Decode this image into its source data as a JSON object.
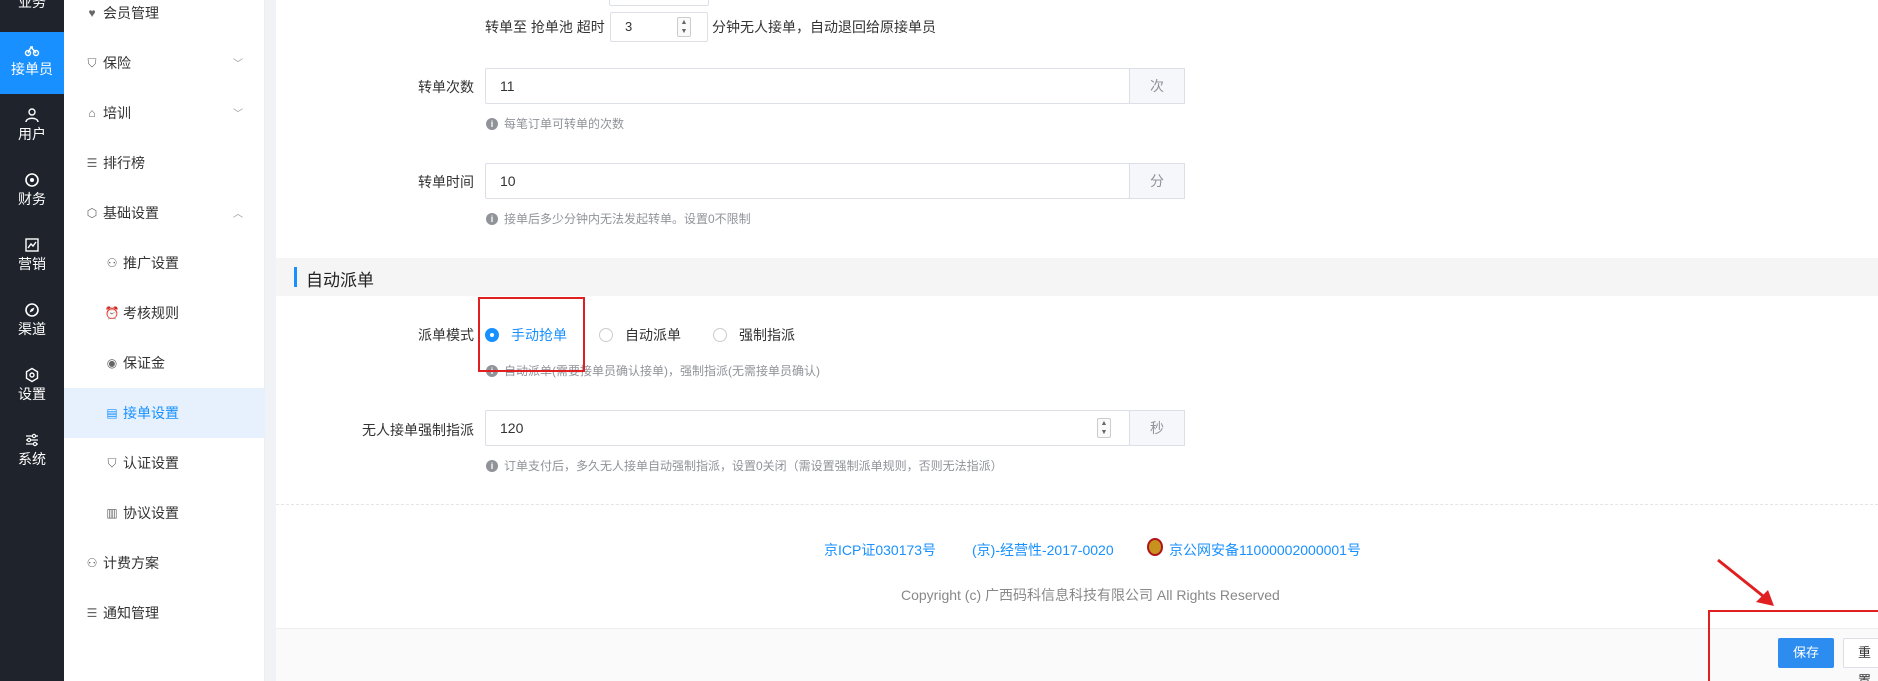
{
  "rail": {
    "top_label": "业务",
    "items": [
      {
        "label": "接单员",
        "icon": "bike-icon"
      },
      {
        "label": "用户",
        "icon": "user-icon"
      },
      {
        "label": "财务",
        "icon": "money-icon"
      },
      {
        "label": "营销",
        "icon": "chart-icon"
      },
      {
        "label": "渠道",
        "icon": "compass-icon"
      },
      {
        "label": "设置",
        "icon": "gear-icon"
      },
      {
        "label": "系统",
        "icon": "sliders-icon"
      }
    ]
  },
  "sidebar": {
    "items": [
      {
        "label": "会员管理"
      },
      {
        "label": "保险"
      },
      {
        "label": "培训"
      },
      {
        "label": "排行榜"
      },
      {
        "label": "基础设置"
      },
      {
        "label": "推广设置"
      },
      {
        "label": "考核规则"
      },
      {
        "label": "保证金"
      },
      {
        "label": "接单设置"
      },
      {
        "label": "认证设置"
      },
      {
        "label": "协议设置"
      },
      {
        "label": "计费方案"
      },
      {
        "label": "通知管理"
      }
    ]
  },
  "transfer_pool": {
    "prefix": "转单至 抢单池 超时",
    "value": "3",
    "suffix": "分钟无人接单，自动退回给原接单员"
  },
  "transfer_count": {
    "label": "转单次数",
    "value": "11",
    "unit": "次",
    "hint": "每笔订单可转单的次数"
  },
  "transfer_time": {
    "label": "转单时间",
    "value": "10",
    "unit": "分",
    "hint": "接单后多少分钟内无法发起转单。设置0不限制"
  },
  "section": {
    "title": "自动派单"
  },
  "dispatch_mode": {
    "label": "派单模式",
    "options": [
      "手动抢单",
      "自动派单",
      "强制指派"
    ],
    "selected": "手动抢单",
    "hint": "自动派单(需要接单员确认接单)，强制指派(无需接单员确认)"
  },
  "force_assign": {
    "label": "无人接单强制指派",
    "value": "120",
    "unit": "秒",
    "hint": "订单支付后，多久无人接单自动强制指派，设置0关闭（需设置强制派单规则，否则无法指派）"
  },
  "footer": {
    "icp": "京ICP证030173号",
    "license": "(京)-经营性-2017-0020",
    "police": "京公网安备11000002000001号",
    "copyright": "Copyright (c) 广西码科信息科技有限公司 All Rights Reserved"
  },
  "actions": {
    "save": "保存",
    "reset": "重置"
  },
  "colors": {
    "accent": "#1890ff",
    "rail_bg": "#1f232b",
    "annotation": "#e02020"
  }
}
